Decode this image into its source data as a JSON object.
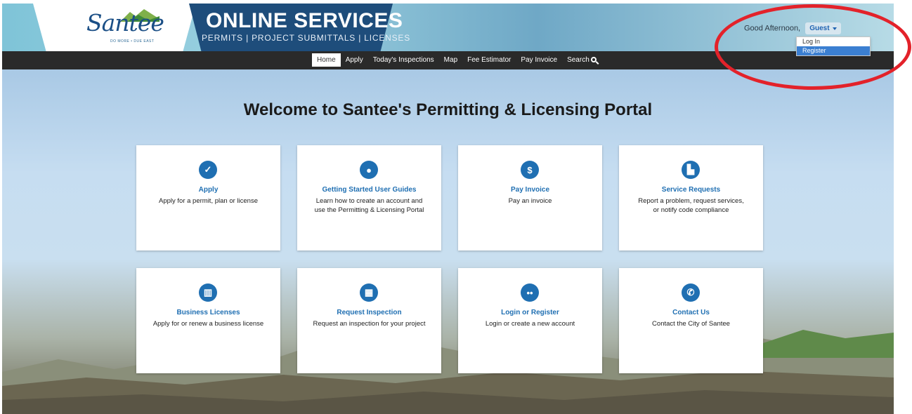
{
  "header": {
    "logo_text": "Santee",
    "logo_tagline": "DO MORE • DUE EAST",
    "title": "ONLINE SERVICES",
    "subtitle": "PERMITS | PROJECT SUBMITTALS | LICENSES"
  },
  "user": {
    "greeting": "Good Afternoon,",
    "name": "Guest",
    "menu": [
      {
        "label": "Log In"
      },
      {
        "label": "Register"
      }
    ]
  },
  "nav": {
    "items": [
      "Home",
      "Apply",
      "Today's Inspections",
      "Map",
      "Fee Estimator",
      "Pay Invoice",
      "Search"
    ],
    "active": "Home"
  },
  "main": {
    "welcome": "Welcome to Santee's Permitting & Licensing Portal"
  },
  "cards": [
    {
      "title": "Apply",
      "desc": "Apply for a permit, plan or license",
      "icon": "clipboard-check-icon"
    },
    {
      "title": "Getting Started User Guides",
      "desc": "Learn how to create an account and use the Permitting & Licensing Portal",
      "icon": "user-icon"
    },
    {
      "title": "Pay Invoice",
      "desc": "Pay an invoice",
      "icon": "dollar-icon"
    },
    {
      "title": "Service Requests",
      "desc": "Report a problem, request services, or notify code compliance",
      "icon": "factory-icon"
    },
    {
      "title": "Business Licenses",
      "desc": "Apply for or renew a business license",
      "icon": "building-icon"
    },
    {
      "title": "Request Inspection",
      "desc": "Request an inspection for your project",
      "icon": "calendar-icon"
    },
    {
      "title": "Login or Register",
      "desc": "Login or create a new account",
      "icon": "users-icon"
    },
    {
      "title": "Contact Us",
      "desc": "Contact the City of Santee",
      "icon": "phone-icon"
    }
  ],
  "colors": {
    "accent": "#1f6fb2",
    "navbar": "#2a2a2a",
    "annotation": "#e3222a"
  }
}
